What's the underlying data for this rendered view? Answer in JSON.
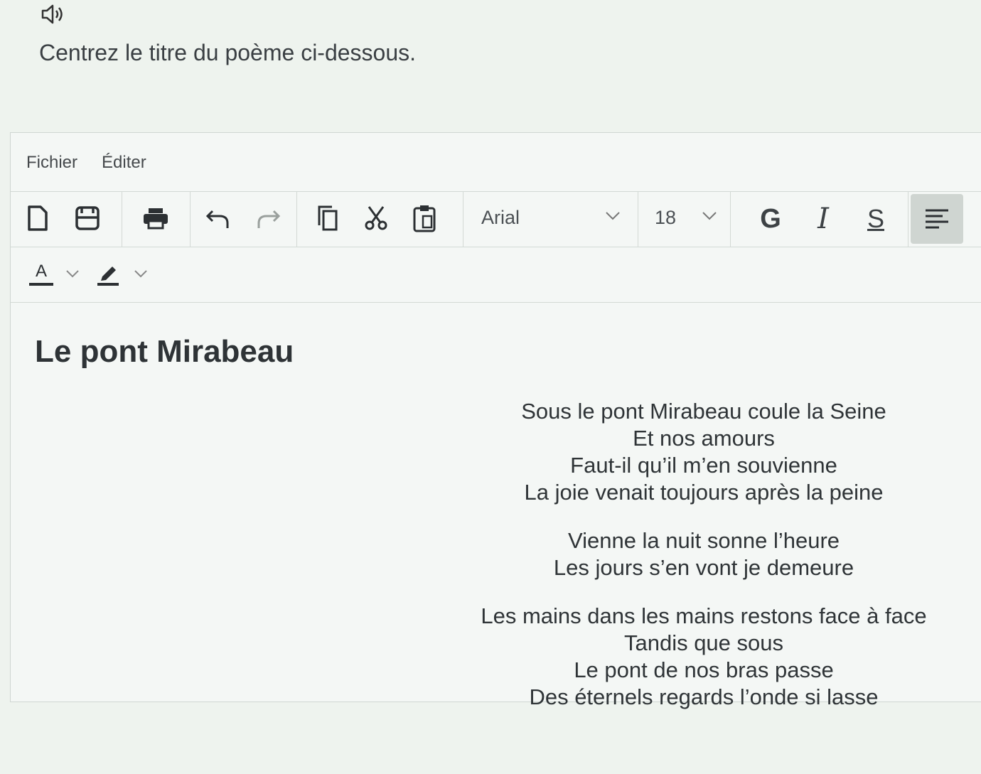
{
  "instruction": {
    "text": "Centrez le titre du poème ci-dessous.",
    "icon": "speaker-icon"
  },
  "menu": {
    "file": "Fichier",
    "edit": "Éditer"
  },
  "toolbar": {
    "icons": [
      "new-file-icon",
      "save-icon",
      "print-icon",
      "undo-icon",
      "redo-icon",
      "copy-icon",
      "cut-icon",
      "paste-icon",
      "align-left-icon"
    ],
    "font_family": "Arial",
    "font_size": "18",
    "bold_label": "G",
    "italic_label": "I",
    "strike_label": "S",
    "text_color_label": "A",
    "active_alignment": "left"
  },
  "document": {
    "title": "Le pont Mirabeau",
    "stanzas": [
      [
        "Sous le pont Mirabeau coule la Seine",
        "Et nos amours",
        "Faut-il qu’il m’en souvienne",
        "La joie venait toujours après la peine"
      ],
      [
        "Vienne la nuit sonne l’heure",
        "Les jours s’en vont je demeure"
      ],
      [
        "Les mains dans les mains restons face à face",
        "Tandis que sous",
        "Le pont de nos bras passe",
        "Des éternels regards l’onde si lasse"
      ]
    ]
  },
  "colors": {
    "background": "#eef3ee",
    "text": "#2f3437",
    "border": "#d3d9d5",
    "active_button": "#cfd5d1"
  }
}
